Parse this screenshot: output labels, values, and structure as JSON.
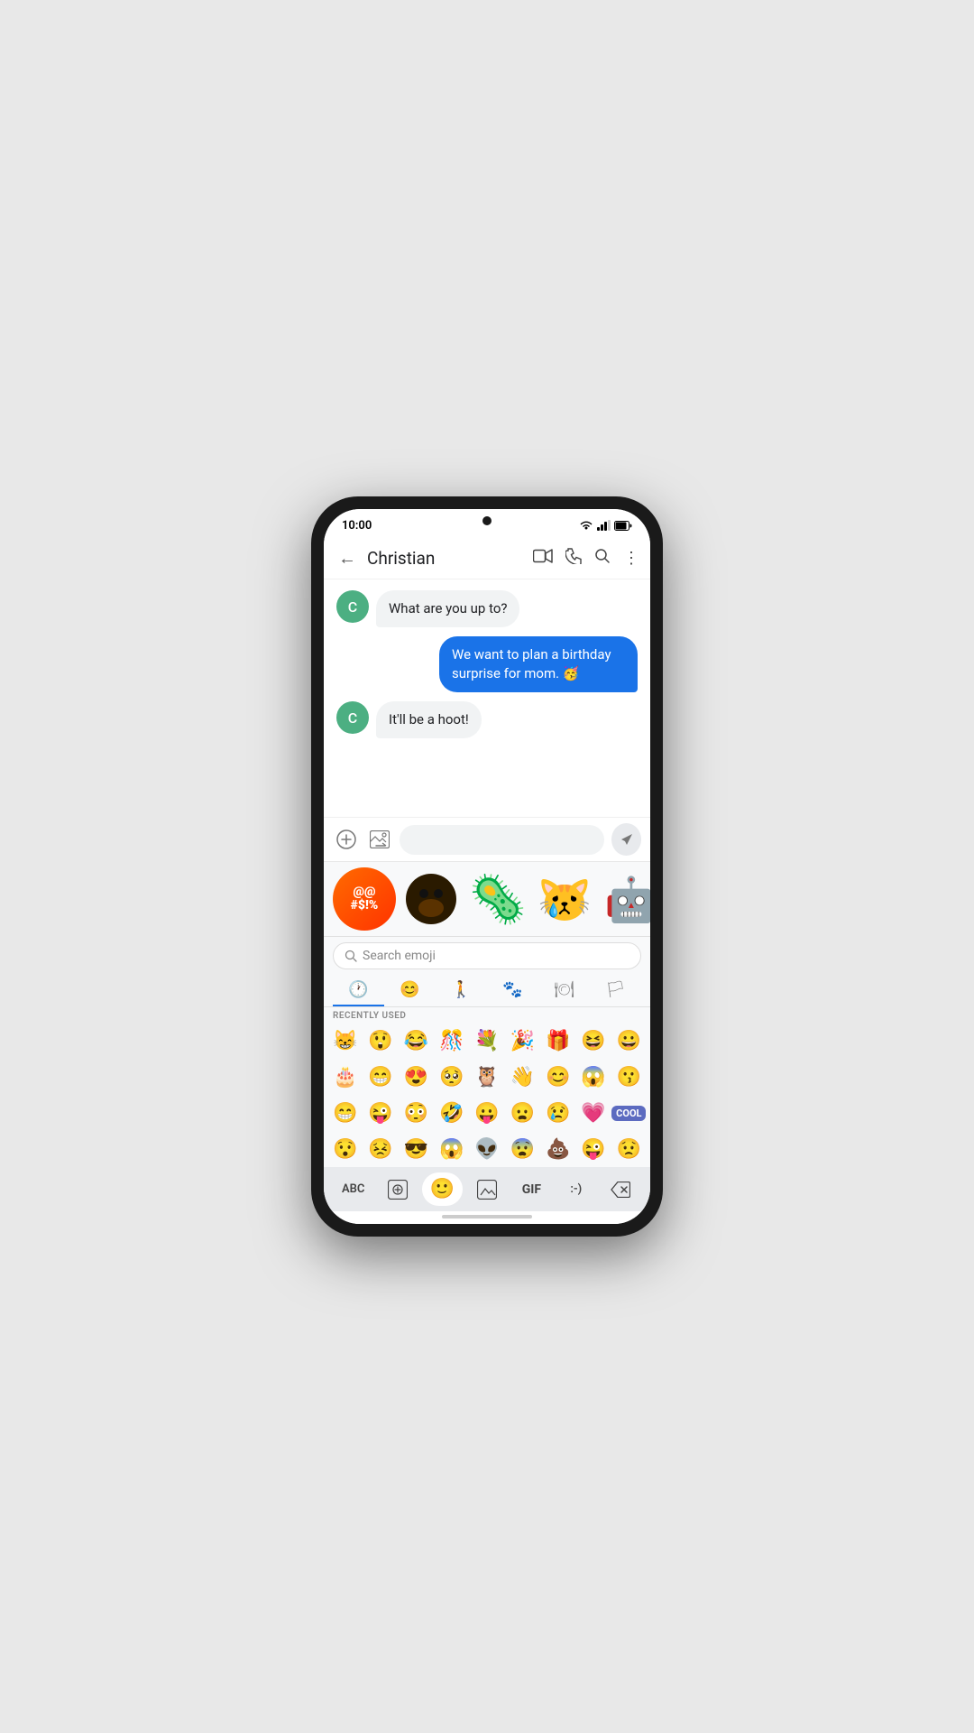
{
  "status": {
    "time": "10:00",
    "wifi_icon": "▼",
    "signal_icon": "▲"
  },
  "header": {
    "back_label": "←",
    "contact_name": "Christian",
    "video_icon": "⬜",
    "phone_icon": "📞",
    "search_icon": "🔍",
    "more_icon": "⋮"
  },
  "messages": [
    {
      "id": "msg1",
      "type": "received",
      "avatar_letter": "C",
      "text": "What are you up to?"
    },
    {
      "id": "msg2",
      "type": "sent",
      "text": "We want to plan a birthday surprise for mom. 🥳"
    },
    {
      "id": "msg3",
      "type": "received",
      "avatar_letter": "C",
      "text": "It'll be a hoot!"
    }
  ],
  "input": {
    "placeholder": "",
    "add_icon": "+",
    "image_icon": "🖼",
    "send_icon": "➤"
  },
  "stickers": [
    {
      "id": "s1",
      "type": "text",
      "label": "@@ #$!%"
    },
    {
      "id": "s2",
      "type": "face",
      "emoji": "🟤"
    },
    {
      "id": "s3",
      "type": "emoji_large",
      "emoji": "🦠"
    },
    {
      "id": "s4",
      "type": "emoji_large",
      "emoji": "😿"
    },
    {
      "id": "s5",
      "type": "emoji_large",
      "emoji": "🤖"
    }
  ],
  "emoji_keyboard": {
    "search_placeholder": "Search emoji",
    "tabs": [
      {
        "id": "recent",
        "icon": "🕐",
        "active": true
      },
      {
        "id": "smileys",
        "icon": "😊",
        "active": false
      },
      {
        "id": "people",
        "icon": "🚶",
        "active": false
      },
      {
        "id": "animals",
        "icon": "🐾",
        "active": false
      },
      {
        "id": "food",
        "icon": "🍽",
        "active": false
      },
      {
        "id": "flags",
        "icon": "🏳",
        "active": false
      }
    ],
    "section_label": "RECENTLY USED",
    "emoji_rows": [
      [
        "😸",
        "😲",
        "😂",
        "🎊",
        "💐",
        "🎉",
        "🎁",
        "😆",
        "😀"
      ],
      [
        "🎂",
        "😁",
        "😍",
        "🥺",
        "🦉",
        "👋",
        "😊",
        "😱",
        "😗"
      ],
      [
        "😁",
        "😜",
        "😳",
        "🤣",
        "😛",
        "😦",
        "😢",
        "💗",
        "COOL"
      ],
      [
        "😯",
        "😣",
        "😎",
        "😱",
        "👽",
        "😨",
        "💩",
        "😜",
        "😟"
      ]
    ]
  },
  "keyboard_bar": {
    "abc_label": "ABC",
    "sticker_icon": "📋",
    "emoji_icon": "😊",
    "gif_icon": "GIF",
    "emoticon_icon": ":-)",
    "delete_icon": "⌫"
  }
}
